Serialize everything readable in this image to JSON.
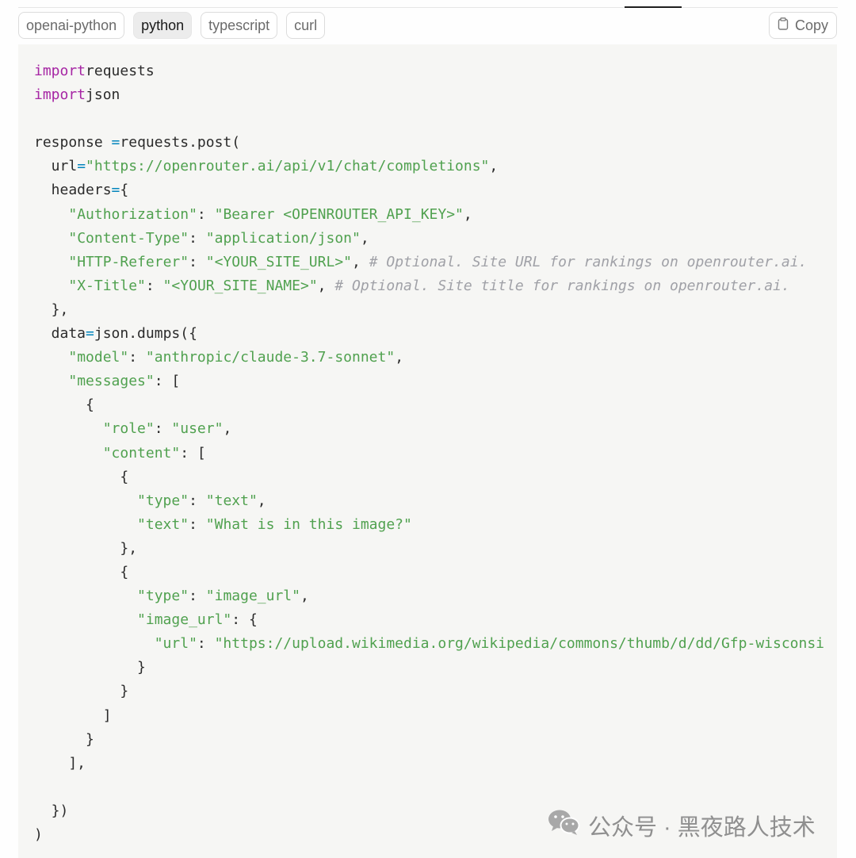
{
  "tabs": [
    {
      "label": "openai-python",
      "active": false
    },
    {
      "label": "python",
      "active": true
    },
    {
      "label": "typescript",
      "active": false
    },
    {
      "label": "curl",
      "active": false
    }
  ],
  "copy_label": "Copy",
  "code_lines": [
    [
      [
        "kw",
        "import"
      ],
      [
        "",
        "requests"
      ]
    ],
    [
      [
        "kw",
        "import"
      ],
      [
        "",
        "json"
      ]
    ],
    [],
    [
      [
        "",
        "response "
      ],
      [
        "op",
        "="
      ],
      [
        "",
        "requests.post("
      ]
    ],
    [
      [
        "",
        "  url"
      ],
      [
        "op",
        "="
      ],
      [
        "str",
        "\"https://openrouter.ai/api/v1/chat/completions\""
      ],
      [
        "",
        ","
      ]
    ],
    [
      [
        "",
        "  headers"
      ],
      [
        "op",
        "="
      ],
      [
        "",
        "{"
      ]
    ],
    [
      [
        "",
        "    "
      ],
      [
        "str",
        "\"Authorization\""
      ],
      [
        "",
        ": "
      ],
      [
        "str",
        "\"Bearer <OPENROUTER_API_KEY>\""
      ],
      [
        "",
        ","
      ]
    ],
    [
      [
        "",
        "    "
      ],
      [
        "str",
        "\"Content-Type\""
      ],
      [
        "",
        ": "
      ],
      [
        "str",
        "\"application/json\""
      ],
      [
        "",
        ","
      ]
    ],
    [
      [
        "",
        "    "
      ],
      [
        "str",
        "\"HTTP-Referer\""
      ],
      [
        "",
        ": "
      ],
      [
        "str",
        "\"<YOUR_SITE_URL>\""
      ],
      [
        "",
        ", "
      ],
      [
        "cm",
        "# Optional. Site URL for rankings on openrouter.ai."
      ]
    ],
    [
      [
        "",
        "    "
      ],
      [
        "str",
        "\"X-Title\""
      ],
      [
        "",
        ": "
      ],
      [
        "str",
        "\"<YOUR_SITE_NAME>\""
      ],
      [
        "",
        ", "
      ],
      [
        "cm",
        "# Optional. Site title for rankings on openrouter.ai."
      ]
    ],
    [
      [
        "",
        "  },"
      ]
    ],
    [
      [
        "",
        "  data"
      ],
      [
        "op",
        "="
      ],
      [
        "",
        "json.dumps({"
      ]
    ],
    [
      [
        "",
        "    "
      ],
      [
        "str",
        "\"model\""
      ],
      [
        "",
        ": "
      ],
      [
        "str",
        "\"anthropic/claude-3.7-sonnet\""
      ],
      [
        "",
        ","
      ]
    ],
    [
      [
        "",
        "    "
      ],
      [
        "str",
        "\"messages\""
      ],
      [
        "",
        ": ["
      ]
    ],
    [
      [
        "",
        "      {"
      ]
    ],
    [
      [
        "",
        "        "
      ],
      [
        "str",
        "\"role\""
      ],
      [
        "",
        ": "
      ],
      [
        "str",
        "\"user\""
      ],
      [
        "",
        ","
      ]
    ],
    [
      [
        "",
        "        "
      ],
      [
        "str",
        "\"content\""
      ],
      [
        "",
        ": ["
      ]
    ],
    [
      [
        "",
        "          {"
      ]
    ],
    [
      [
        "",
        "            "
      ],
      [
        "str",
        "\"type\""
      ],
      [
        "",
        ": "
      ],
      [
        "str",
        "\"text\""
      ],
      [
        "",
        ","
      ]
    ],
    [
      [
        "",
        "            "
      ],
      [
        "str",
        "\"text\""
      ],
      [
        "",
        ": "
      ],
      [
        "str",
        "\"What is in this image?\""
      ]
    ],
    [
      [
        "",
        "          },"
      ]
    ],
    [
      [
        "",
        "          {"
      ]
    ],
    [
      [
        "",
        "            "
      ],
      [
        "str",
        "\"type\""
      ],
      [
        "",
        ": "
      ],
      [
        "str",
        "\"image_url\""
      ],
      [
        "",
        ","
      ]
    ],
    [
      [
        "",
        "            "
      ],
      [
        "str",
        "\"image_url\""
      ],
      [
        "",
        ": {"
      ]
    ],
    [
      [
        "",
        "              "
      ],
      [
        "str",
        "\"url\""
      ],
      [
        "",
        ": "
      ],
      [
        "str",
        "\"https://upload.wikimedia.org/wikipedia/commons/thumb/d/dd/Gfp-wisconsi"
      ]
    ],
    [
      [
        "",
        "            }"
      ]
    ],
    [
      [
        "",
        "          }"
      ]
    ],
    [
      [
        "",
        "        ]"
      ]
    ],
    [
      [
        "",
        "      }"
      ]
    ],
    [
      [
        "",
        "    ],"
      ]
    ],
    [],
    [
      [
        "",
        "  })"
      ]
    ],
    [
      [
        "",
        ")"
      ]
    ]
  ],
  "watermark": {
    "icon": "wechat-icon",
    "text": "公众号 · 黑夜路人技术"
  },
  "colors": {
    "keyword": "#a626a4",
    "string": "#50a14f",
    "operator": "#0184bc",
    "comment": "#a0a1a7",
    "code_bg": "#f6f6f4"
  }
}
